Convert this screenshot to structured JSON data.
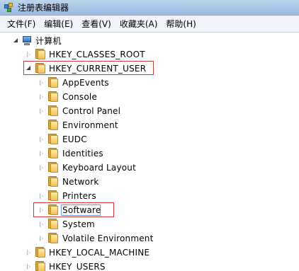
{
  "window": {
    "title": "注册表编辑器"
  },
  "menu": [
    {
      "label": "文件(F)"
    },
    {
      "label": "编辑(E)"
    },
    {
      "label": "查看(V)"
    },
    {
      "label": "收藏夹(A)"
    },
    {
      "label": "帮助(H)"
    }
  ],
  "tree": {
    "root": "计算机",
    "hives": {
      "classes_root": "HKEY_CLASSES_ROOT",
      "current_user": "HKEY_CURRENT_USER",
      "local_machine": "HKEY_LOCAL_MACHINE",
      "users": "HKEY_USERS"
    },
    "current_user_children": [
      "AppEvents",
      "Console",
      "Control Panel",
      "Environment",
      "EUDC",
      "Identities",
      "Keyboard Layout",
      "Network",
      "Printers",
      "Software",
      "System",
      "Volatile Environment"
    ]
  },
  "colors": {
    "highlight_border": "#d23a3a",
    "edit_border": "#6a9be0",
    "folder": "#f2c354"
  },
  "icons": {
    "root": "computer-icon",
    "key": "folder-icon",
    "collapsed": "triangle-right-icon",
    "expanded": "triangle-down-icon"
  }
}
